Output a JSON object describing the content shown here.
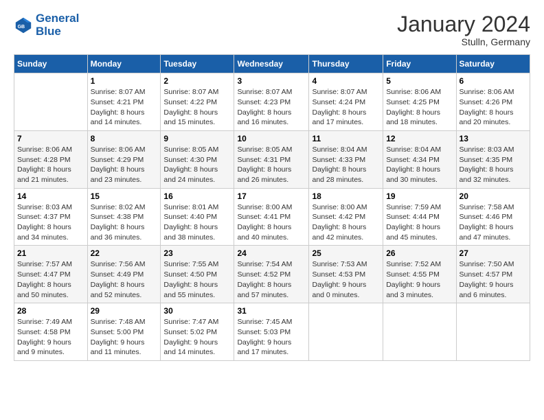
{
  "header": {
    "logo_text_1": "General",
    "logo_text_2": "Blue",
    "month": "January 2024",
    "location": "Stulln, Germany"
  },
  "weekdays": [
    "Sunday",
    "Monday",
    "Tuesday",
    "Wednesday",
    "Thursday",
    "Friday",
    "Saturday"
  ],
  "weeks": [
    [
      {
        "day": "",
        "info": ""
      },
      {
        "day": "1",
        "info": "Sunrise: 8:07 AM\nSunset: 4:21 PM\nDaylight: 8 hours\nand 14 minutes."
      },
      {
        "day": "2",
        "info": "Sunrise: 8:07 AM\nSunset: 4:22 PM\nDaylight: 8 hours\nand 15 minutes."
      },
      {
        "day": "3",
        "info": "Sunrise: 8:07 AM\nSunset: 4:23 PM\nDaylight: 8 hours\nand 16 minutes."
      },
      {
        "day": "4",
        "info": "Sunrise: 8:07 AM\nSunset: 4:24 PM\nDaylight: 8 hours\nand 17 minutes."
      },
      {
        "day": "5",
        "info": "Sunrise: 8:06 AM\nSunset: 4:25 PM\nDaylight: 8 hours\nand 18 minutes."
      },
      {
        "day": "6",
        "info": "Sunrise: 8:06 AM\nSunset: 4:26 PM\nDaylight: 8 hours\nand 20 minutes."
      }
    ],
    [
      {
        "day": "7",
        "info": "Sunrise: 8:06 AM\nSunset: 4:28 PM\nDaylight: 8 hours\nand 21 minutes."
      },
      {
        "day": "8",
        "info": "Sunrise: 8:06 AM\nSunset: 4:29 PM\nDaylight: 8 hours\nand 23 minutes."
      },
      {
        "day": "9",
        "info": "Sunrise: 8:05 AM\nSunset: 4:30 PM\nDaylight: 8 hours\nand 24 minutes."
      },
      {
        "day": "10",
        "info": "Sunrise: 8:05 AM\nSunset: 4:31 PM\nDaylight: 8 hours\nand 26 minutes."
      },
      {
        "day": "11",
        "info": "Sunrise: 8:04 AM\nSunset: 4:33 PM\nDaylight: 8 hours\nand 28 minutes."
      },
      {
        "day": "12",
        "info": "Sunrise: 8:04 AM\nSunset: 4:34 PM\nDaylight: 8 hours\nand 30 minutes."
      },
      {
        "day": "13",
        "info": "Sunrise: 8:03 AM\nSunset: 4:35 PM\nDaylight: 8 hours\nand 32 minutes."
      }
    ],
    [
      {
        "day": "14",
        "info": "Sunrise: 8:03 AM\nSunset: 4:37 PM\nDaylight: 8 hours\nand 34 minutes."
      },
      {
        "day": "15",
        "info": "Sunrise: 8:02 AM\nSunset: 4:38 PM\nDaylight: 8 hours\nand 36 minutes."
      },
      {
        "day": "16",
        "info": "Sunrise: 8:01 AM\nSunset: 4:40 PM\nDaylight: 8 hours\nand 38 minutes."
      },
      {
        "day": "17",
        "info": "Sunrise: 8:00 AM\nSunset: 4:41 PM\nDaylight: 8 hours\nand 40 minutes."
      },
      {
        "day": "18",
        "info": "Sunrise: 8:00 AM\nSunset: 4:42 PM\nDaylight: 8 hours\nand 42 minutes."
      },
      {
        "day": "19",
        "info": "Sunrise: 7:59 AM\nSunset: 4:44 PM\nDaylight: 8 hours\nand 45 minutes."
      },
      {
        "day": "20",
        "info": "Sunrise: 7:58 AM\nSunset: 4:46 PM\nDaylight: 8 hours\nand 47 minutes."
      }
    ],
    [
      {
        "day": "21",
        "info": "Sunrise: 7:57 AM\nSunset: 4:47 PM\nDaylight: 8 hours\nand 50 minutes."
      },
      {
        "day": "22",
        "info": "Sunrise: 7:56 AM\nSunset: 4:49 PM\nDaylight: 8 hours\nand 52 minutes."
      },
      {
        "day": "23",
        "info": "Sunrise: 7:55 AM\nSunset: 4:50 PM\nDaylight: 8 hours\nand 55 minutes."
      },
      {
        "day": "24",
        "info": "Sunrise: 7:54 AM\nSunset: 4:52 PM\nDaylight: 8 hours\nand 57 minutes."
      },
      {
        "day": "25",
        "info": "Sunrise: 7:53 AM\nSunset: 4:53 PM\nDaylight: 9 hours\nand 0 minutes."
      },
      {
        "day": "26",
        "info": "Sunrise: 7:52 AM\nSunset: 4:55 PM\nDaylight: 9 hours\nand 3 minutes."
      },
      {
        "day": "27",
        "info": "Sunrise: 7:50 AM\nSunset: 4:57 PM\nDaylight: 9 hours\nand 6 minutes."
      }
    ],
    [
      {
        "day": "28",
        "info": "Sunrise: 7:49 AM\nSunset: 4:58 PM\nDaylight: 9 hours\nand 9 minutes."
      },
      {
        "day": "29",
        "info": "Sunrise: 7:48 AM\nSunset: 5:00 PM\nDaylight: 9 hours\nand 11 minutes."
      },
      {
        "day": "30",
        "info": "Sunrise: 7:47 AM\nSunset: 5:02 PM\nDaylight: 9 hours\nand 14 minutes."
      },
      {
        "day": "31",
        "info": "Sunrise: 7:45 AM\nSunset: 5:03 PM\nDaylight: 9 hours\nand 17 minutes."
      },
      {
        "day": "",
        "info": ""
      },
      {
        "day": "",
        "info": ""
      },
      {
        "day": "",
        "info": ""
      }
    ]
  ]
}
